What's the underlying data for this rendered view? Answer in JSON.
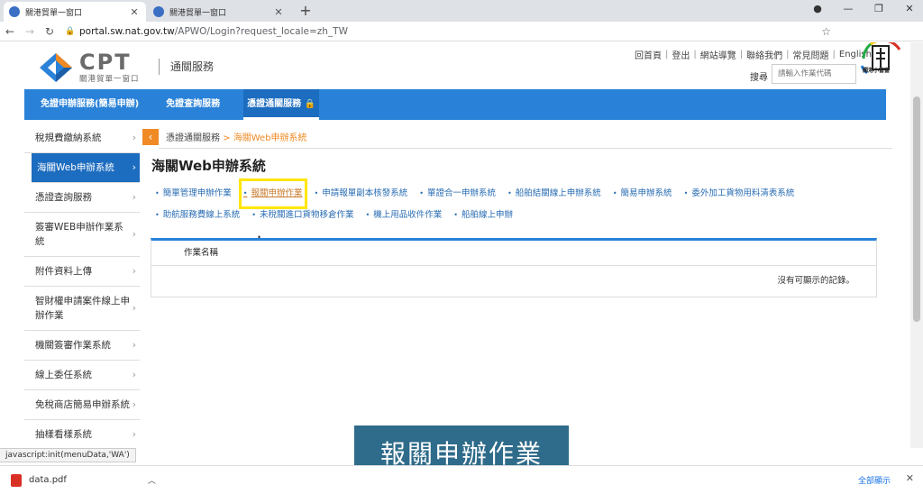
{
  "browser": {
    "tabs": [
      {
        "title": "關港貿單一窗口",
        "active": true
      },
      {
        "title": "關港貿單一窗口",
        "active": false
      }
    ],
    "new_tab": "+",
    "url_host": "portal.sw.nat.gov.tw",
    "url_path": "/APWO/Login?request_locale=zh_TW"
  },
  "header": {
    "logo_big": "CPT",
    "logo_sub": "關港貿單一窗口",
    "site_title": "通關服務",
    "top_links": [
      "回首頁",
      "登出",
      "網站導覽",
      "聯絡我們",
      "常見問題",
      "English"
    ],
    "search_label": "搜尋",
    "search_placeholder": "請輸入作業代碼",
    "mascot_tag": "關港小窗窗"
  },
  "nav": {
    "items": [
      "免證申辦服務(簡易申辦)",
      "免證查詢服務",
      "憑證通關服務 🔒"
    ]
  },
  "sidebar": {
    "items": [
      "稅規費繳納系統",
      "海關Web申辦系統",
      "憑證查詢服務",
      "簽審WEB申辦作業系統",
      "附件資料上傳",
      "智財權申請案件線上申辦作業",
      "機關簽審作業系統",
      "線上委任系統",
      "免稅商店簡易申辦系統",
      "抽樣看樣系統"
    ],
    "active_index": 1
  },
  "breadcrumb": {
    "root": "憑證通關服務",
    "sep": " > ",
    "current": "海關Web申辦系統"
  },
  "content": {
    "title": "海關Web申辦系統",
    "links": [
      "簡單管理申辦作業",
      "報關申辦作業",
      "申請報單副本核發系統",
      "單證合一申辦系統",
      "船舶結關線上申辦系統",
      "簡易申辦系統",
      "委外加工貨物用料清表系統",
      "助航服務費線上系統",
      "未稅關進口貨物移倉作業",
      "機上用品收件作業",
      "船舶線上申辦"
    ],
    "highlighted_index": 1,
    "table_header": "作業名稱",
    "table_empty": "沒有可顯示的記錄。"
  },
  "caption": "報關申辦作業",
  "status_text": "javascript:init(menuData,'WA')",
  "downloads": {
    "file": "data.pdf",
    "show_all": "全部顯示"
  },
  "colors": {
    "nav_blue": "#2a82d8",
    "active_blue": "#1c6cbf",
    "accent_orange": "#f08a24",
    "highlight_yellow": "#ffe600",
    "caption_bg": "#2f6b8a"
  }
}
